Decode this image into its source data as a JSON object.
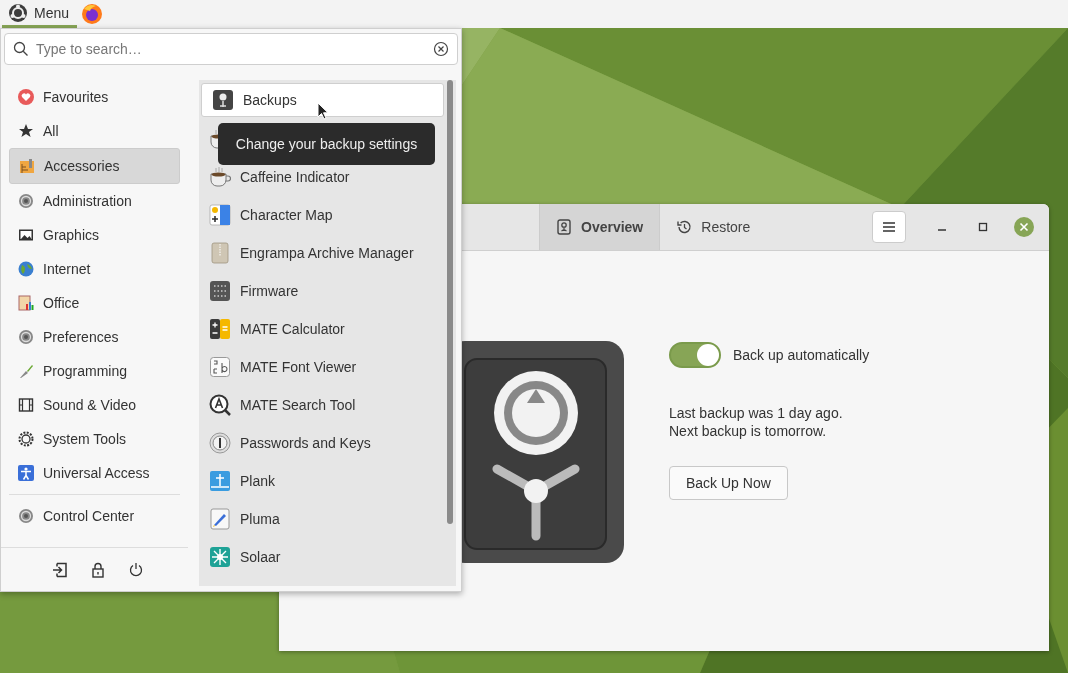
{
  "panel": {
    "menu_label": "Menu"
  },
  "menu": {
    "search": {
      "placeholder": "Type to search…"
    },
    "categories": [
      {
        "label": "Favourites",
        "selected": false
      },
      {
        "label": "All",
        "selected": false
      },
      {
        "label": "Accessories",
        "selected": true
      },
      {
        "label": "Administration",
        "selected": false
      },
      {
        "label": "Graphics",
        "selected": false
      },
      {
        "label": "Internet",
        "selected": false
      },
      {
        "label": "Office",
        "selected": false
      },
      {
        "label": "Preferences",
        "selected": false
      },
      {
        "label": "Programming",
        "selected": false
      },
      {
        "label": "Sound & Video",
        "selected": false
      },
      {
        "label": "System Tools",
        "selected": false
      },
      {
        "label": "Universal Access",
        "selected": false
      }
    ],
    "control_center": "Control Center",
    "apps": [
      {
        "name": "Backups",
        "selected": true
      },
      {
        "selected": false
      },
      {
        "name": "Caffeine Indicator",
        "selected": false
      },
      {
        "name": "Character Map",
        "selected": false
      },
      {
        "name": "Engrampa Archive Manager",
        "selected": false
      },
      {
        "name": "Firmware",
        "selected": false
      },
      {
        "name": "MATE Calculator",
        "selected": false
      },
      {
        "name": "MATE Font Viewer",
        "selected": false
      },
      {
        "name": "MATE Search Tool",
        "selected": false
      },
      {
        "name": "Passwords and Keys",
        "selected": false
      },
      {
        "name": "Plank",
        "selected": false
      },
      {
        "name": "Pluma",
        "selected": false
      },
      {
        "name": "Solaar",
        "selected": false
      }
    ],
    "tooltip": "Change your backup settings"
  },
  "window": {
    "tabs": [
      {
        "label": "Overview",
        "selected": true
      },
      {
        "label": "Restore",
        "selected": false
      }
    ],
    "auto_backup": {
      "label": "Back up automatically",
      "on": true
    },
    "status_lines": [
      "Last backup was 1 day ago.",
      "Next backup is tomorrow."
    ],
    "button": "Back Up Now"
  }
}
